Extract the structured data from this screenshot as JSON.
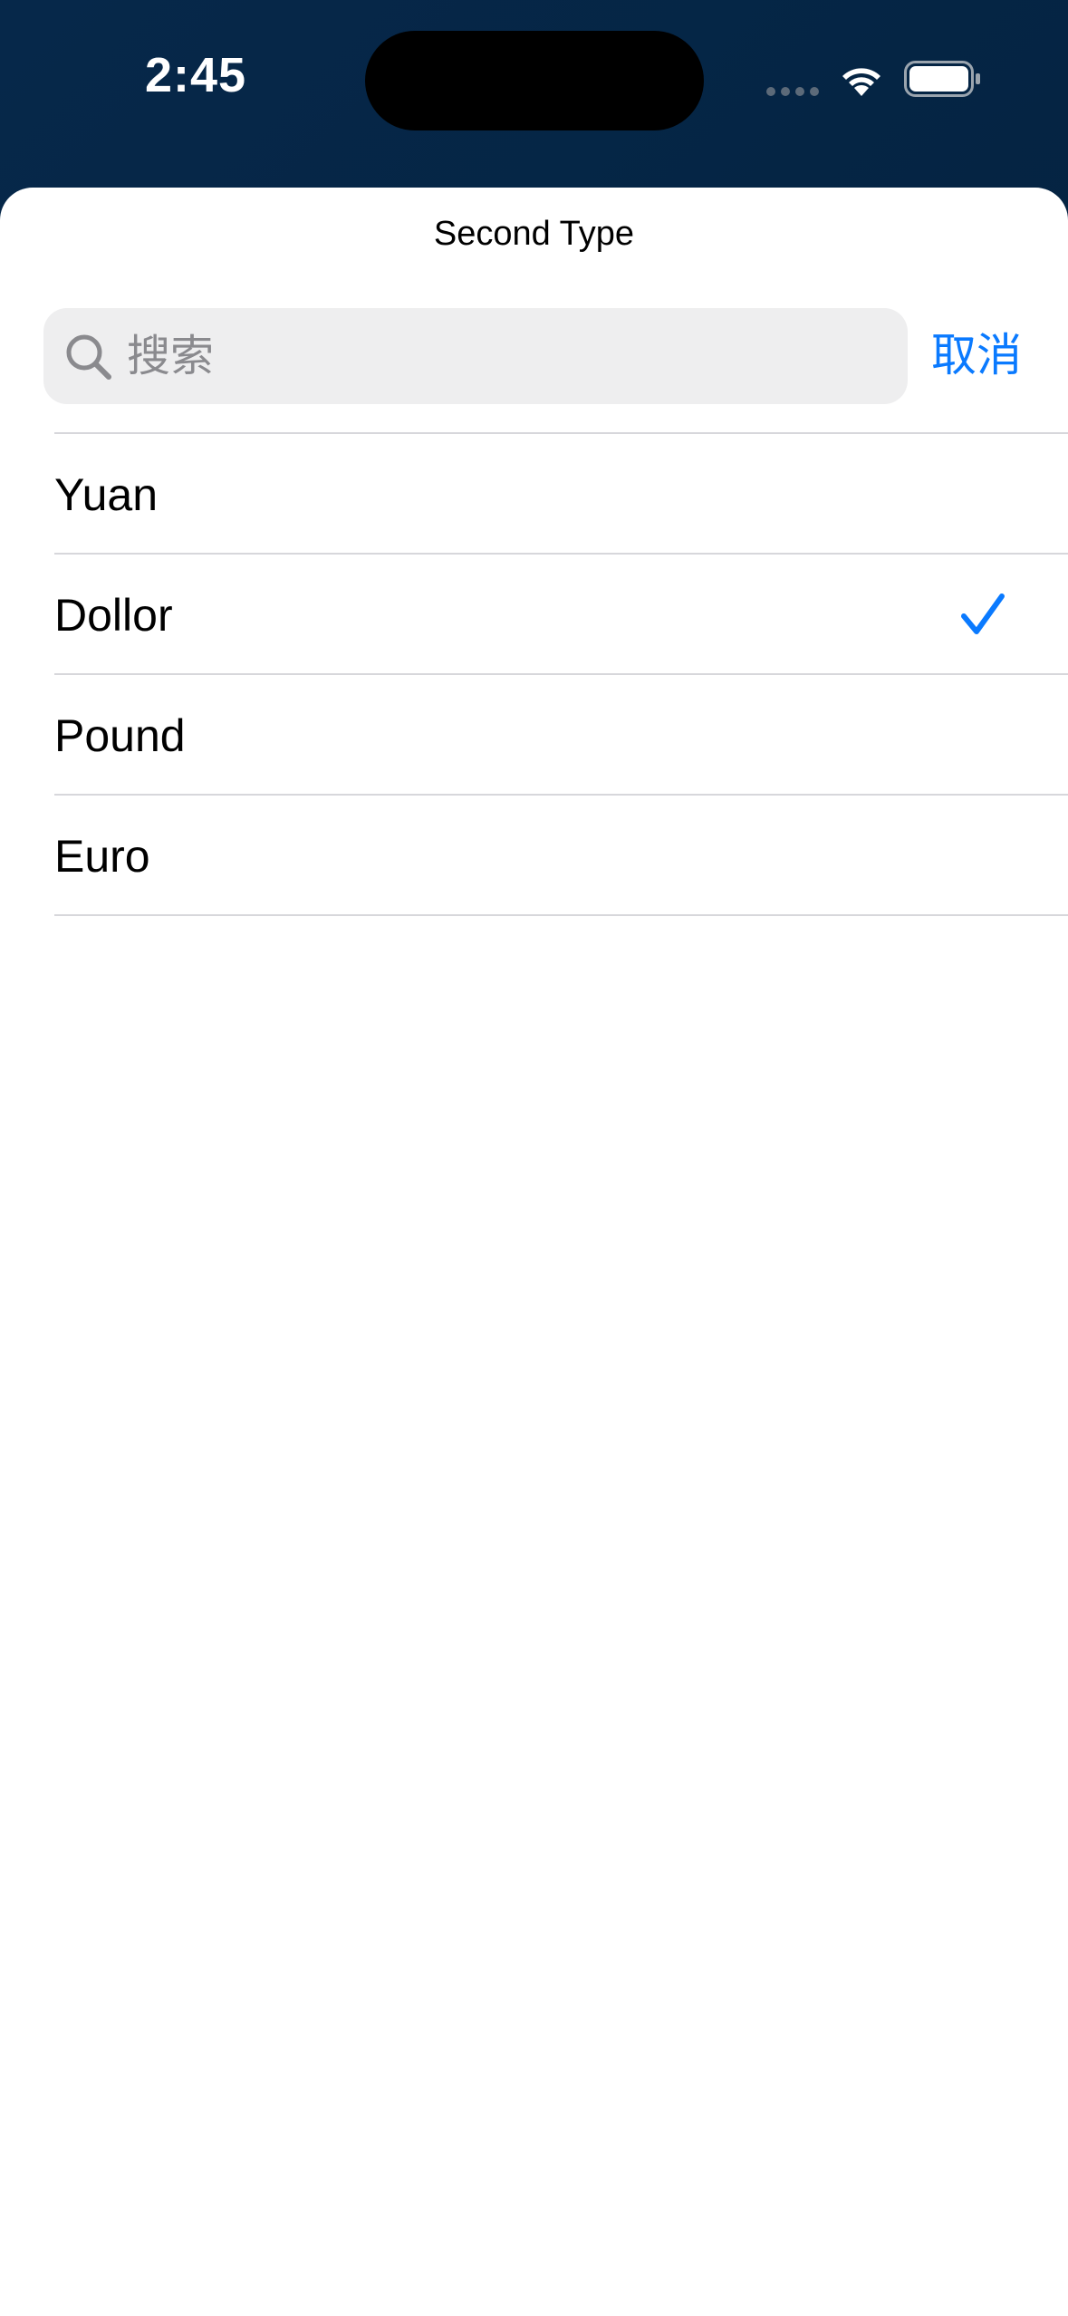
{
  "status_bar": {
    "time": "2:45"
  },
  "sheet": {
    "title": "Second Type",
    "search": {
      "placeholder": "搜索",
      "value": ""
    },
    "cancel_label": "取消",
    "accent_color": "#0a7aff",
    "items": [
      {
        "label": "Yuan",
        "selected": false
      },
      {
        "label": "Dollor",
        "selected": true
      },
      {
        "label": "Pound",
        "selected": false
      },
      {
        "label": "Euro",
        "selected": false
      }
    ]
  }
}
